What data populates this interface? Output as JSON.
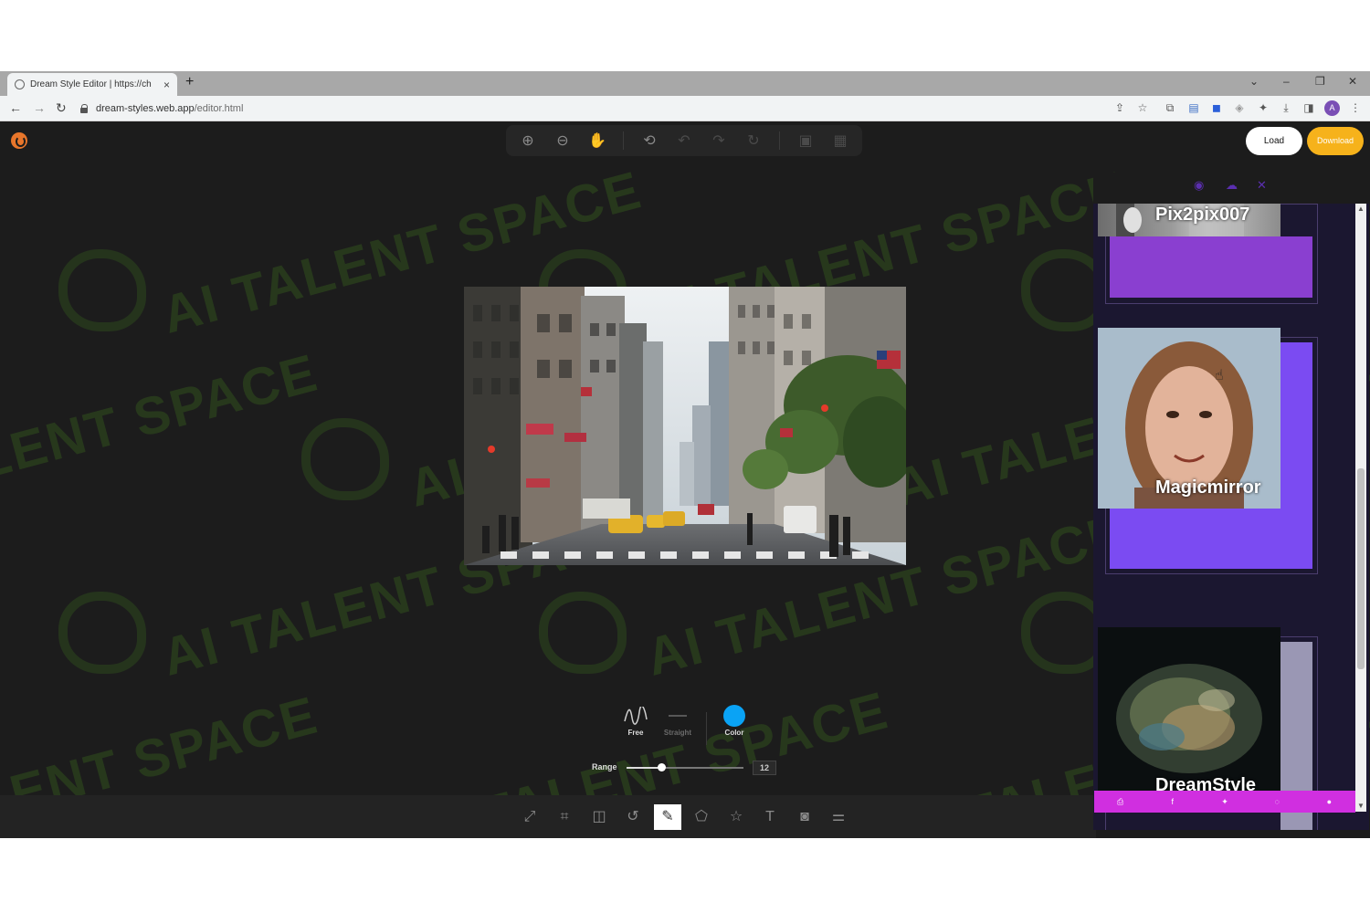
{
  "browser": {
    "tab_title": "Dream Style Editor | https://ch",
    "new_tab": "+",
    "close_tab": "×",
    "url_host": "dream-styles.web.app",
    "url_path": "/editor.html",
    "profile_initial": "A",
    "window_controls": [
      "⌄",
      "–",
      "❐",
      "✕"
    ]
  },
  "header": {
    "load_label": "Load",
    "download_label": "Download",
    "toolbar_icons": [
      "zoom-in-icon",
      "zoom-out-icon",
      "hand-icon",
      "history-icon",
      "undo-icon",
      "redo-icon",
      "reset-icon",
      "delete-icon",
      "delete-all-icon"
    ]
  },
  "watermark": {
    "text": "AI TALENT SPACE",
    "partial": "LENT SPACE"
  },
  "draw_controls": {
    "free_label": "Free",
    "straight_label": "Straight",
    "color_label": "Color",
    "color_value": "#0aa3f5",
    "range_label": "Range",
    "range_value": "12",
    "range_fraction": 0.3
  },
  "bottom_toolbar": {
    "tools": [
      "resize-icon",
      "crop-icon",
      "flip-icon",
      "rotate-icon",
      "draw-icon",
      "shape-icon",
      "icon-icon",
      "text-icon",
      "mask-icon",
      "filter-icon"
    ],
    "active_tool": "draw-icon"
  },
  "styles_panel": {
    "cards": [
      {
        "label": "Pix2pix007",
        "accent": "#8a3fd0"
      },
      {
        "label": "Magicmirror",
        "accent": "#7b4bf2"
      },
      {
        "label": "DreamStyle",
        "accent": "#9a97b4"
      }
    ],
    "panel_icons": [
      "eye-off-icon",
      "cloud-upload-icon",
      "expand-icon"
    ],
    "share_icons": [
      "print-icon",
      "facebook-icon",
      "twitter-icon",
      "whatsapp-icon",
      "messenger-icon"
    ]
  }
}
